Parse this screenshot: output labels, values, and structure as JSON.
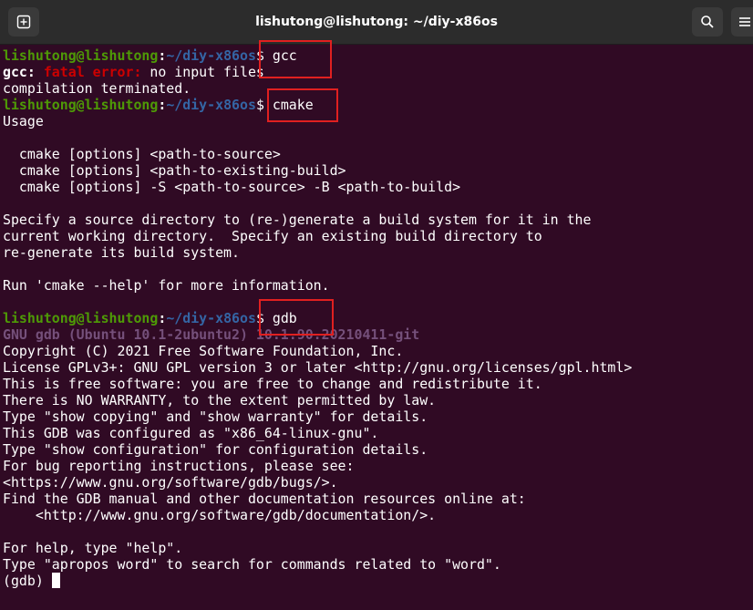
{
  "window": {
    "title": "lishutong@lishutong: ~/diy-x86os",
    "icons": [
      "new-tab-icon",
      "search-icon",
      "menu-icon"
    ]
  },
  "colors": {
    "background": "#300a24",
    "prompt_user": "#4e9a06",
    "prompt_path": "#3465a4",
    "error": "#cc0000",
    "gdb_header": "#75507b",
    "highlight_box": "#e02020"
  },
  "prompt": {
    "user": "lishutong@lishutong",
    "sep": ":",
    "path": "~/diy-x86os",
    "dollar": "$"
  },
  "commands": {
    "gcc": " gcc",
    "cmake": " cmake",
    "gdb": " gdb"
  },
  "output": {
    "gcc_prefix": "gcc: ",
    "gcc_error": "fatal error: ",
    "gcc_msg": "no input files",
    "gcc_term": "compilation terminated.",
    "cmake_usage": "Usage",
    "cmake_u1": "  cmake [options] <path-to-source>",
    "cmake_u2": "  cmake [options] <path-to-existing-build>",
    "cmake_u3": "  cmake [options] -S <path-to-source> -B <path-to-build>",
    "cmake_s1": "Specify a source directory to (re-)generate a build system for it in the",
    "cmake_s2": "current working directory.  Specify an existing build directory to",
    "cmake_s3": "re-generate its build system.",
    "cmake_help": "Run 'cmake --help' for more information.",
    "gdb_header": "GNU gdb (Ubuntu 10.1-2ubuntu2) 10.1.90.20210411-git",
    "gdb_l1": "Copyright (C) 2021 Free Software Foundation, Inc.",
    "gdb_l2": "License GPLv3+: GNU GPL version 3 or later <http://gnu.org/licenses/gpl.html>",
    "gdb_l3": "This is free software: you are free to change and redistribute it.",
    "gdb_l4": "There is NO WARRANTY, to the extent permitted by law.",
    "gdb_l5": "Type \"show copying\" and \"show warranty\" for details.",
    "gdb_l6": "This GDB was configured as \"x86_64-linux-gnu\".",
    "gdb_l7": "Type \"show configuration\" for configuration details.",
    "gdb_l8": "For bug reporting instructions, please see:",
    "gdb_l9": "<https://www.gnu.org/software/gdb/bugs/>.",
    "gdb_l10": "Find the GDB manual and other documentation resources online at:",
    "gdb_l11": "    <http://www.gnu.org/software/gdb/documentation/>.",
    "gdb_l12": "For help, type \"help\".",
    "gdb_l13": "Type \"apropos word\" to search for commands related to \"word\".",
    "gdb_prompt": "(gdb) "
  }
}
